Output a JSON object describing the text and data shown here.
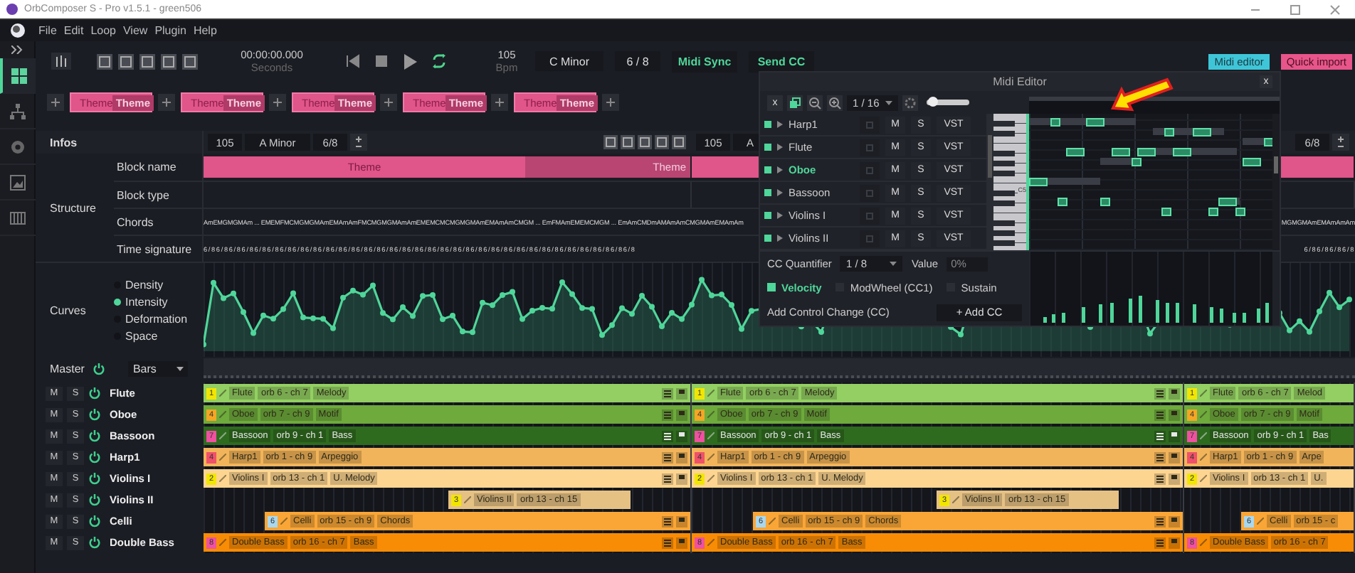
{
  "window": {
    "title": "OrbComposer S - Pro v1.5.1 - green506"
  },
  "menu": [
    "File",
    "Edit",
    "Loop",
    "View",
    "Plugin",
    "Help"
  ],
  "sidebar": {
    "items": [
      {
        "kind": "grid",
        "selected": true
      },
      {
        "kind": "network",
        "selected": false
      },
      {
        "kind": "gear",
        "selected": false
      },
      {
        "kind": "image",
        "selected": false
      },
      {
        "kind": "piano",
        "selected": false
      }
    ]
  },
  "toolbar": {
    "time": "00:00:00.000",
    "time_unit": "Seconds",
    "tempo": "105",
    "tempo_unit": "Bpm",
    "key": "C Minor",
    "meter": "6 / 8",
    "sync_buttons": [
      "Midi Sync",
      "Send CC"
    ],
    "midi_editor_button": "Midi editor",
    "quick_import_button": "Quick import"
  },
  "themes": [
    {
      "label": "Theme",
      "tag": "Theme"
    },
    {
      "label": "Theme",
      "tag": "Theme"
    },
    {
      "label": "Theme",
      "tag": "Theme"
    },
    {
      "label": "Theme",
      "tag": "Theme"
    },
    {
      "label": "Theme",
      "tag": "Theme"
    }
  ],
  "infos": {
    "label": "Infos"
  },
  "blocks": [
    {
      "tempo": "105",
      "key": "A Minor",
      "meter": "6/8",
      "name": "Theme",
      "name_tag": "Theme"
    },
    {
      "tempo": "105",
      "key": "A"
    },
    {
      "meter": "6/8"
    }
  ],
  "structure": {
    "label": "Structure",
    "rows": [
      "Block name",
      "Block type",
      "Chords",
      "Time signature"
    ]
  },
  "chords": [
    "AmEMGMGMAm ... EMEMFMCMGMGMAmEMAmAmFMCMGMGMAmAmEMEMCMCMGMGMAmEMAmAmCMGM ... EmFMAmEMEMCMGM ... EmAmCMDmAMAmAmCMGMAmEMAmAm",
    "MGMGMAmEMAmAmAm"
  ],
  "time_signatures": [
    "6/86/86/86/86/86/86/86/86/86/86/86/86/86/86/86/86/86/86/86/86/86/86/86/86/86/86/86/86/86/86/86/86/86/8",
    "6/86/86/86/8"
  ],
  "curves": {
    "label": "Curves",
    "options": [
      {
        "label": "Density",
        "selected": false
      },
      {
        "label": "Intensity",
        "selected": true
      },
      {
        "label": "Deformation",
        "selected": false
      },
      {
        "label": "Space",
        "selected": false
      }
    ]
  },
  "master": {
    "label": "Master",
    "view": "Bars"
  },
  "tracks": [
    {
      "name": "Flute",
      "buttons": [
        "M",
        "S"
      ],
      "color": "#93cf62",
      "clips": [
        {
          "kind": "full",
          "badge": {
            "label": "1",
            "color": "#f2e600"
          },
          "name": "Flute",
          "channel": "orb 6 - ch 7",
          "role": "Melody"
        },
        {
          "kind": "full",
          "badge": {
            "label": "1",
            "color": "#f2e600"
          },
          "name": "Flute",
          "channel": "orb 6 - ch 7",
          "role": "Melody"
        },
        {
          "kind": "cut",
          "badge": {
            "label": "1",
            "color": "#f2e600"
          },
          "name": "Flute",
          "channel": "orb 6 - ch 7",
          "role": "Melod"
        }
      ]
    },
    {
      "name": "Oboe",
      "buttons": [
        "M",
        "S"
      ],
      "color": "#6eaa3c",
      "clips": [
        {
          "kind": "full",
          "badge": {
            "label": "4",
            "color": "#f5a623"
          },
          "name": "Oboe",
          "channel": "orb 7 - ch 9",
          "role": "Motif"
        },
        {
          "kind": "full",
          "badge": {
            "label": "4",
            "color": "#f5a623"
          },
          "name": "Oboe",
          "channel": "orb 7 - ch 9",
          "role": "Motif"
        },
        {
          "kind": "cut",
          "badge": {
            "label": "4",
            "color": "#f5a623"
          },
          "name": "Oboe",
          "channel": "orb 7 - ch 9",
          "role": "Motif"
        }
      ]
    },
    {
      "name": "Bassoon",
      "buttons": [
        "M",
        "S"
      ],
      "color": "#2f6b1f",
      "clips": [
        {
          "kind": "full",
          "badge": {
            "label": "7",
            "color": "#f050a0"
          },
          "name": "Bassoon",
          "channel": "orb 9 - ch 1",
          "role": "Bass"
        },
        {
          "kind": "full",
          "badge": {
            "label": "7",
            "color": "#f050a0"
          },
          "name": "Bassoon",
          "channel": "orb 9 - ch 1",
          "role": "Bass"
        },
        {
          "kind": "cut",
          "badge": {
            "label": "7",
            "color": "#f050a0"
          },
          "name": "Bassoon",
          "channel": "orb 9 - ch 1",
          "role": "Bas"
        }
      ]
    },
    {
      "name": "Harp1",
      "buttons": [
        "M",
        "S"
      ],
      "color": "#f2b45a",
      "clips": [
        {
          "kind": "full",
          "badge": {
            "label": "4",
            "color": "#f0506a"
          },
          "name": "Harp1",
          "channel": "orb 1 - ch 9",
          "role": "Arpeggio"
        },
        {
          "kind": "full",
          "badge": {
            "label": "4",
            "color": "#f0506a"
          },
          "name": "Harp1",
          "channel": "orb 1 - ch 9",
          "role": "Arpeggio"
        },
        {
          "kind": "cut",
          "badge": {
            "label": "4",
            "color": "#f0506a"
          },
          "name": "Harp1",
          "channel": "orb 1 - ch 9",
          "role": "Arpe"
        }
      ]
    },
    {
      "name": "Violins I",
      "buttons": [
        "M",
        "S"
      ],
      "color": "#fdd590",
      "clips": [
        {
          "kind": "full",
          "badge": {
            "label": "2",
            "color": "#f2e600"
          },
          "name": "Violins I",
          "channel": "orb 13 - ch 1",
          "role": "U. Melody"
        },
        {
          "kind": "full",
          "badge": {
            "label": "2",
            "color": "#f2e600"
          },
          "name": "Violins I",
          "channel": "orb 13 - ch 1",
          "role": "U. Melody"
        },
        {
          "kind": "cut",
          "badge": {
            "label": "2",
            "color": "#f2e600"
          },
          "name": "Violins I",
          "channel": "orb 13 - ch 1",
          "role": "U."
        }
      ]
    },
    {
      "name": "Violins II",
      "buttons": [
        "M",
        "S"
      ],
      "color": "#e6c184",
      "clips": [
        {
          "kind": "middle",
          "badge": {
            "label": "3",
            "color": "#f2e600"
          },
          "name": "Violins II",
          "channel": "orb 13 - ch 15"
        },
        {
          "kind": "middle",
          "badge": {
            "label": "3",
            "color": "#f2e600"
          },
          "name": "Violins II",
          "channel": "orb 13 - ch 15"
        }
      ]
    },
    {
      "name": "Celli",
      "buttons": [
        "M",
        "S"
      ],
      "color": "#f9a637",
      "clips": [
        {
          "kind": "tail",
          "badge": {
            "label": "6",
            "color": "#a8d8f0"
          },
          "name": "Celli",
          "channel": "orb 15 - ch 9",
          "role": "Chords"
        },
        {
          "kind": "tail",
          "badge": {
            "label": "6",
            "color": "#a8d8f0"
          },
          "name": "Celli",
          "channel": "orb 15 - ch 9",
          "role": "Chords"
        },
        {
          "kind": "tailcut",
          "badge": {
            "label": "6",
            "color": "#a8d8f0"
          },
          "name": "Celli",
          "channel": "orb 15 - c"
        }
      ]
    },
    {
      "name": "Double Bass",
      "buttons": [
        "M",
        "S"
      ],
      "color": "#f98c05",
      "clips": [
        {
          "kind": "full",
          "badge": {
            "label": "8",
            "color": "#f050a0"
          },
          "name": "Double Bass",
          "channel": "orb 16 - ch 7",
          "role": "Bass"
        },
        {
          "kind": "full",
          "badge": {
            "label": "8",
            "color": "#f050a0"
          },
          "name": "Double Bass",
          "channel": "orb 16 - ch 7",
          "role": "Bass"
        },
        {
          "kind": "cut",
          "badge": {
            "label": "8",
            "color": "#f050a0"
          },
          "name": "Double Bass",
          "channel": "orb 16 - ch 7"
        }
      ]
    }
  ],
  "midi_editor": {
    "title": "Midi Editor",
    "close": "x",
    "toolbar_close": "x",
    "grid": "1 / 16",
    "zoom": {
      "level": 0.15
    },
    "key_label": "C5",
    "tracks": [
      {
        "name": "Harp1",
        "selected": false,
        "buttons": [
          "M",
          "S",
          "VST"
        ]
      },
      {
        "name": "Flute",
        "selected": false,
        "buttons": [
          "M",
          "S",
          "VST"
        ]
      },
      {
        "name": "Oboe",
        "selected": true,
        "buttons": [
          "M",
          "S",
          "VST"
        ]
      },
      {
        "name": "Bassoon",
        "selected": false,
        "buttons": [
          "M",
          "S",
          "VST"
        ]
      },
      {
        "name": "Violins I",
        "selected": false,
        "buttons": [
          "M",
          "S",
          "VST"
        ]
      },
      {
        "name": "Violins II",
        "selected": false,
        "buttons": [
          "M",
          "S",
          "VST"
        ]
      }
    ],
    "cc_quantifier": {
      "label": "CC Quantifier",
      "value": "1 / 8"
    },
    "value": {
      "label": "Value",
      "value": "0%"
    },
    "cc_options": [
      {
        "label": "Velocity",
        "checked": true
      },
      {
        "label": "ModWheel (CC1)",
        "checked": false
      },
      {
        "label": "Sustain",
        "checked": false
      }
    ],
    "add_cc": {
      "label": "Add Control Change (CC)",
      "button": "+ Add CC"
    }
  }
}
